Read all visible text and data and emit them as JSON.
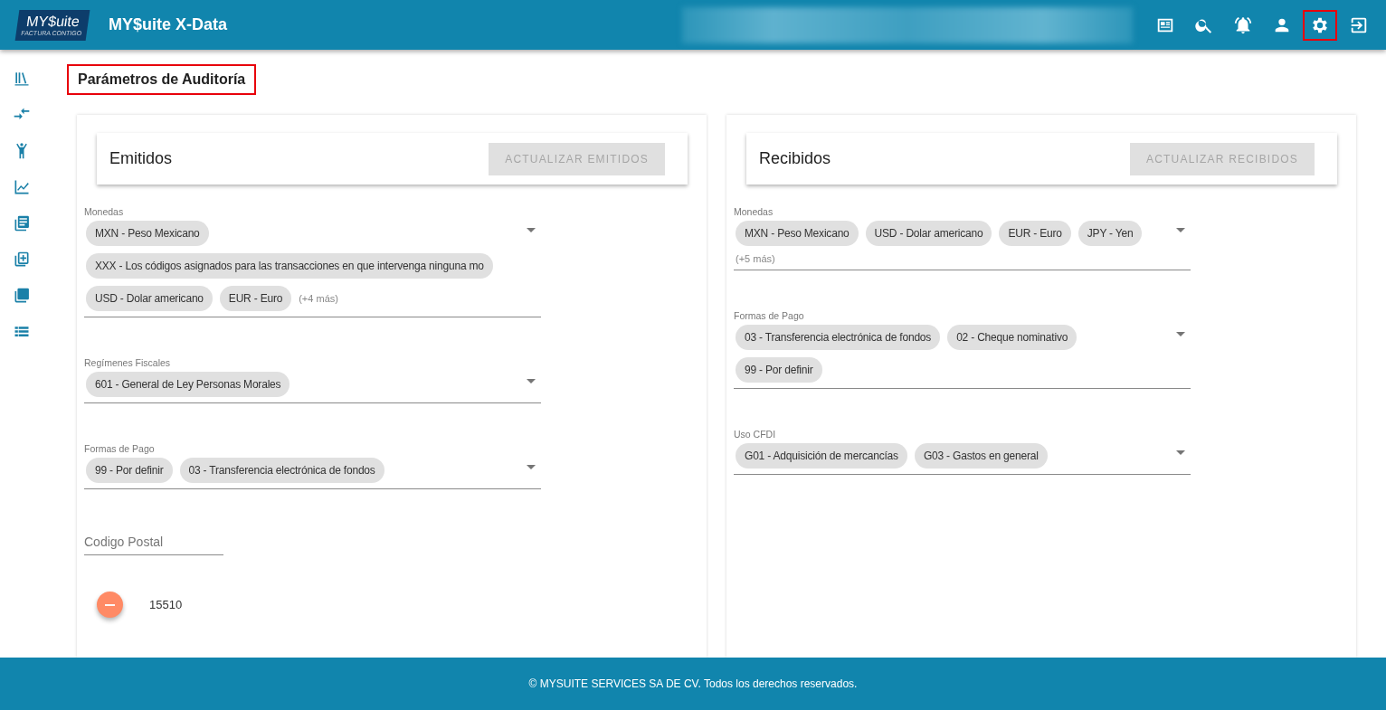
{
  "header": {
    "logo": {
      "brand": "MY$uite",
      "tagline": "FACTURA CONTIGO"
    },
    "title": "MY$uite X-Data",
    "toolbar": [
      {
        "kind": "news",
        "highlighted": false
      },
      {
        "kind": "search",
        "highlighted": false
      },
      {
        "kind": "alarm",
        "highlighted": false
      },
      {
        "kind": "person",
        "highlighted": false
      },
      {
        "kind": "settings",
        "highlighted": true
      },
      {
        "kind": "logout",
        "highlighted": false
      }
    ]
  },
  "sidebar": {
    "items": [
      {
        "kind": "library"
      },
      {
        "kind": "compare"
      },
      {
        "kind": "person"
      },
      {
        "kind": "chart"
      },
      {
        "kind": "articles"
      },
      {
        "kind": "select"
      },
      {
        "kind": "layers"
      },
      {
        "kind": "list"
      }
    ]
  },
  "page_title": {
    "text": "Parámetros de Auditoría",
    "highlighted": true
  },
  "panels": [
    {
      "title": "Emitidos",
      "button": {
        "label": "ACTUALIZAR EMITIDOS",
        "disabled": true
      },
      "fields": [
        {
          "kind": "select",
          "label": "Monedas",
          "chips": [
            "MXN - Peso Mexicano",
            "XXX - Los códigos asignados para las transacciones en que intervenga ninguna mo",
            "USD - Dolar americano",
            "EUR - Euro"
          ],
          "more": "(+4 más)"
        },
        {
          "kind": "select",
          "label": "Regímenes Fiscales",
          "chips": [
            "601 - General de Ley Personas Morales"
          ]
        },
        {
          "kind": "select",
          "label": "Formas de Pago",
          "chips": [
            "99 - Por definir",
            "03 - Transferencia electrónica de fondos"
          ]
        },
        {
          "kind": "text",
          "placeholder": "Codigo Postal"
        },
        {
          "kind": "list",
          "items": [
            {
              "value": "15510"
            }
          ]
        }
      ]
    },
    {
      "title": "Recibidos",
      "button": {
        "label": "ACTUALIZAR RECIBIDOS",
        "disabled": true
      },
      "fields": [
        {
          "kind": "select",
          "label": "Monedas",
          "chips": [
            "MXN - Peso Mexicano",
            "USD - Dolar americano",
            "EUR - Euro",
            "JPY - Yen"
          ],
          "more": "(+5 más)"
        },
        {
          "kind": "select",
          "label": "Formas de Pago",
          "chips": [
            "03 - Transferencia electrónica de fondos",
            "02 - Cheque nominativo",
            "99 - Por definir"
          ]
        },
        {
          "kind": "select",
          "label": "Uso CFDI",
          "chips": [
            "G01 - Adquisición de mercancías",
            "G03 - Gastos en general"
          ]
        }
      ]
    }
  ],
  "footer": "© MYSUITE SERVICES SA DE CV. Todos los derechos reservados."
}
